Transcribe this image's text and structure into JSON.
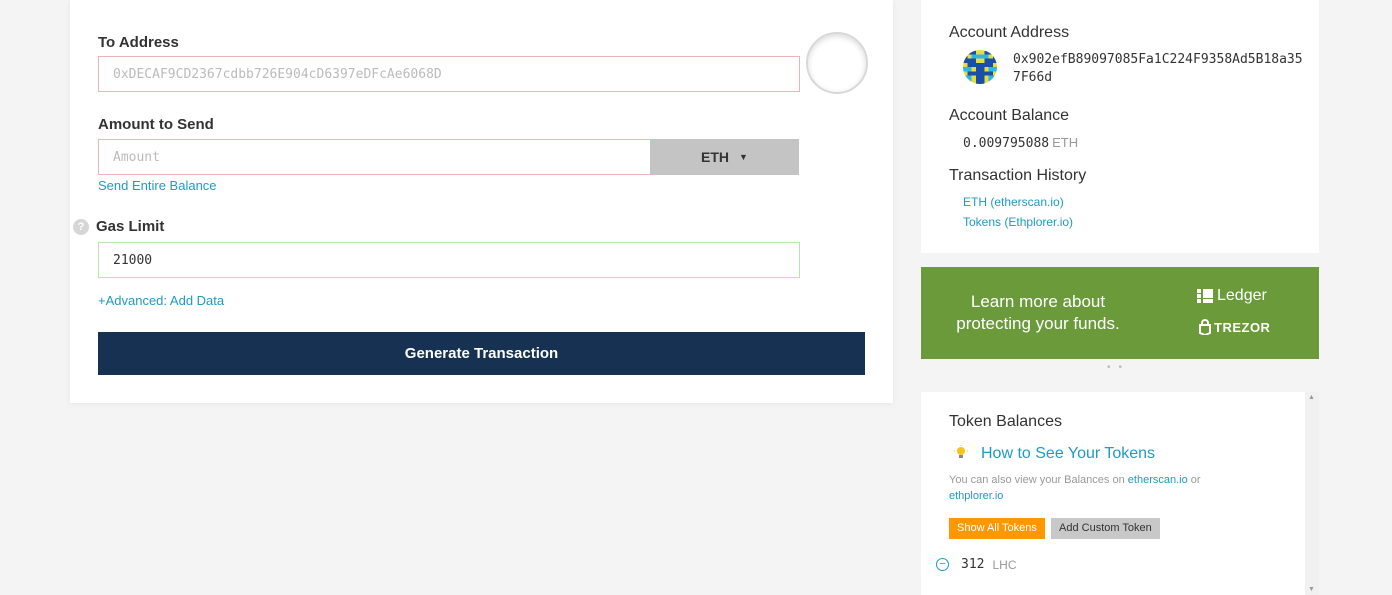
{
  "send": {
    "to_address_label": "To Address",
    "to_address_placeholder": "0xDECAF9CD2367cdbb726E904cD6397eDFcAe6068D",
    "to_address_value": "",
    "amount_label": "Amount to Send",
    "amount_placeholder": "Amount",
    "unit_selected": "ETH",
    "send_entire_balance": "Send Entire Balance",
    "help_icon_glyph": "?",
    "gas_limit_label": "Gas Limit",
    "gas_limit_value": "21000",
    "advanced_link": "+Advanced: Add Data",
    "generate_button": "Generate Transaction"
  },
  "account": {
    "address_title": "Account Address",
    "address": "0x902efB89097085Fa1C224F9358Ad5B18a357F66d",
    "balance_title": "Account Balance",
    "balance_value": "0.009795088",
    "balance_unit": "ETH",
    "history_title": "Transaction History",
    "history_links": [
      "ETH (etherscan.io)",
      "Tokens (Ethplorer.io)"
    ]
  },
  "promo": {
    "text": "Learn more about protecting your funds.",
    "ledger_label": "Ledger",
    "trezor_label": "TREZOR"
  },
  "tokens": {
    "title": "Token Balances",
    "how_link": "How to See Your Tokens",
    "also_prefix": "You can also view your Balances on",
    "also_link1": "etherscan.io",
    "also_or": "or",
    "also_link2": "ethplorer.io",
    "show_all_button": "Show All Tokens",
    "add_custom_button": "Add Custom Token",
    "items": [
      {
        "amount": "312",
        "symbol": "LHC"
      }
    ]
  },
  "colors": {
    "primary_button": "#163151",
    "link": "#1f9bc4",
    "promo_bg": "#6a9a3a",
    "show_all_bg": "#ff9800",
    "error_border": "#f0b3b3",
    "valid_border": "#b9e3b0"
  },
  "icons": [
    "identicon",
    "help-icon",
    "chevron-down-icon",
    "bulb-icon",
    "remove-circle-icon",
    "ledger-logo-icon",
    "trezor-lock-icon",
    "scroll-up-icon",
    "scroll-down-icon"
  ]
}
